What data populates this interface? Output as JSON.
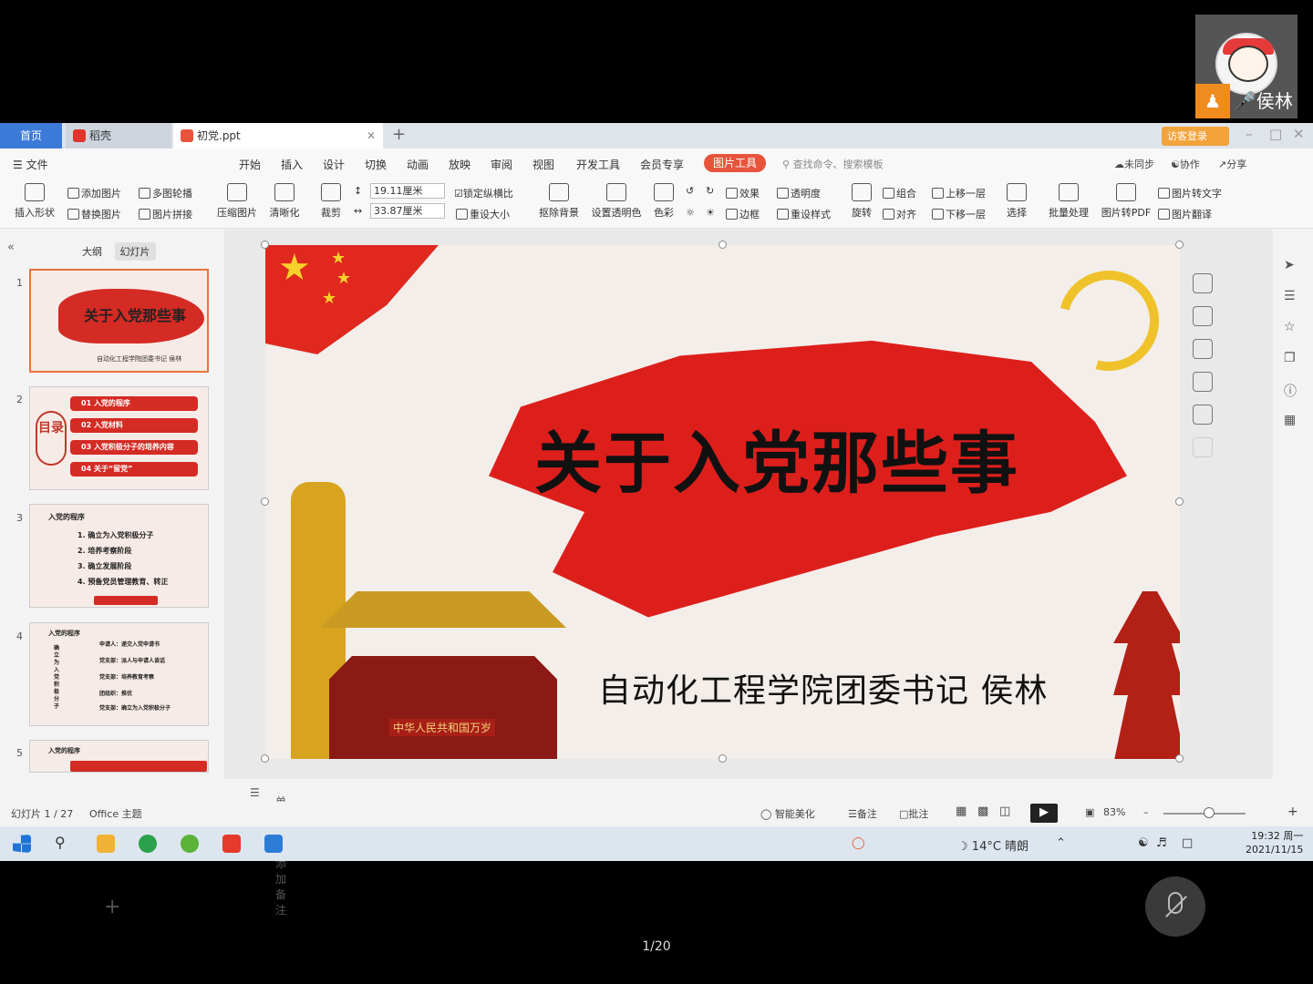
{
  "participant": {
    "name": "侯林"
  },
  "tabs": {
    "home": "首页",
    "docer": "稻壳",
    "file": "初党.ppt",
    "add": "+"
  },
  "titlebar": {
    "login": "访客登录"
  },
  "menu": {
    "file": "☰ 文件",
    "items": [
      "开始",
      "插入",
      "设计",
      "切换",
      "动画",
      "放映",
      "审阅",
      "视图",
      "开发工具",
      "会员专享"
    ],
    "picture_tools": "图片工具",
    "search": "查找命令、搜索模板",
    "sync": "未同步",
    "collab": "协作",
    "share": "分享"
  },
  "ribbon": {
    "insert_shape": "插入形状",
    "add_picture": "添加图片",
    "replace_picture": "替换图片",
    "multi_carousel": "多图轮播",
    "picture_splice": "图片拼接",
    "compress": "压缩图片",
    "clarify": "清晰化",
    "crop": "裁剪",
    "height": "19.11厘米",
    "width": "33.87厘米",
    "lock_ratio": "锁定纵横比",
    "reset_size": "重设大小",
    "remove_bg": "抠除背景",
    "set_transparent": "设置透明色",
    "color": "色彩",
    "effect": "效果",
    "border": "边框",
    "transparency": "透明度",
    "reset_style": "重设样式",
    "rotate": "旋转",
    "group": "组合",
    "align": "对齐",
    "bring_forward": "上移一层",
    "send_backward": "下移一层",
    "select": "选择",
    "batch": "批量处理",
    "to_pdf": "图片转PDF",
    "to_text": "图片转文字",
    "translate": "图片翻译"
  },
  "left_panel": {
    "outline_tab": "大纲",
    "slides_tab": "幻灯片",
    "add": "+"
  },
  "thumbnails": [
    {
      "num": "1",
      "title": "关于入党那些事",
      "sub": "自动化工程学院团委书记 侯林"
    },
    {
      "num": "2",
      "mulu": "目录",
      "lines": [
        "01 入党的程序",
        "02 入党材料",
        "03 入党积极分子的培养内容",
        "04 关于“留党”"
      ]
    },
    {
      "num": "3",
      "head": "入党的程序",
      "lines": [
        "1. 确立为入党积极分子",
        "2. 培养考察阶段",
        "3. 确立发展阶段",
        "4. 预备党员管理教育、转正"
      ]
    },
    {
      "num": "4",
      "head": "入党的程序",
      "side": "确立为入党积极分子",
      "lines": [
        "申请人：递交入党申请书",
        "党支部：派人与申请人谈话",
        "党支部：培养教育考察",
        "团组织：推优",
        "党支部：确立为入党积极分子"
      ]
    },
    {
      "num": "5",
      "head": "入党的程序"
    }
  ],
  "slide": {
    "title": "关于入党那些事",
    "subtitle": "自动化工程学院团委书记  侯林",
    "gate_banner": "中华人民共和国万岁"
  },
  "notes": {
    "placeholder": "单击此处添加备注"
  },
  "status": {
    "slide_counter": "幻灯片 1 / 27",
    "theme": "Office 主题",
    "beautify": "智能美化",
    "notes": "备注",
    "comments": "批注",
    "zoom": "83%"
  },
  "taskbar": {
    "weather": "14°C 晴朗",
    "time": "19:32 周一",
    "date": "2021/11/15"
  },
  "pager": "1/20"
}
